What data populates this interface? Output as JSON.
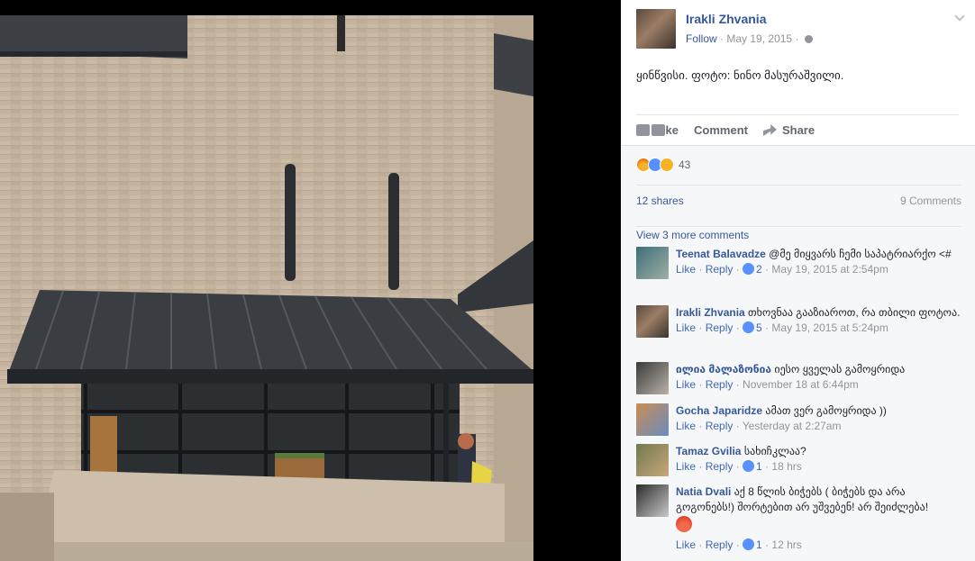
{
  "post": {
    "author": "Irakli Zhvania",
    "follow_label": "Follow",
    "date": "May 19, 2015",
    "text": "ყინწვისი. ფოტო: ნინო მასურაშვილი.",
    "actions": {
      "like": "Like",
      "comment": "Comment",
      "share": "Share"
    }
  },
  "feedback": {
    "reaction_count": "43",
    "shares": "12 shares",
    "comments": "9 Comments",
    "view_more": "View 3 more comments"
  },
  "comments": [
    {
      "author": "Teenat Balavadze",
      "text": "@მე მიყვარს ჩემი საპატრიარქო <#",
      "like": "Like",
      "reply": "Reply",
      "likes": "2",
      "time": "May 19, 2015 at 2:54pm"
    },
    {
      "author": "Irakli Zhvania",
      "text": "თხოვნაა გააზიაროთ, რა თბილი ფოტოა.",
      "like": "Like",
      "reply": "Reply",
      "likes": "5",
      "time": "May 19, 2015 at 5:24pm"
    },
    {
      "author": "ილია მალაზონია",
      "text": "იესო ყველას გამოყრიდა",
      "like": "Like",
      "reply": "Reply",
      "likes": "",
      "time": "November 18 at 6:44pm"
    },
    {
      "author": "Gocha Japaridze",
      "text": "ამათ ვერ გამოყრიდა ))",
      "like": "Like",
      "reply": "Reply",
      "likes": "",
      "time": "Yesterday at 2:27am"
    },
    {
      "author": "Tamaz Gvilia",
      "text": "სახიჩკლაა?",
      "like": "Like",
      "reply": "Reply",
      "likes": "1",
      "time": "18 hrs"
    },
    {
      "author": "Natia Dvali",
      "text": "აქ 8 წლის ბიჭებს ( ბიჭებს და არა გოგონებს!) შორტებით არ უშვებენ! არ შეიძლება!",
      "like": "Like",
      "reply": "Reply",
      "likes": "1",
      "time": "12 hrs"
    }
  ],
  "colors": {
    "link": "#365899",
    "meta": "#90949c",
    "panel_bg": "#f6f7f9"
  }
}
